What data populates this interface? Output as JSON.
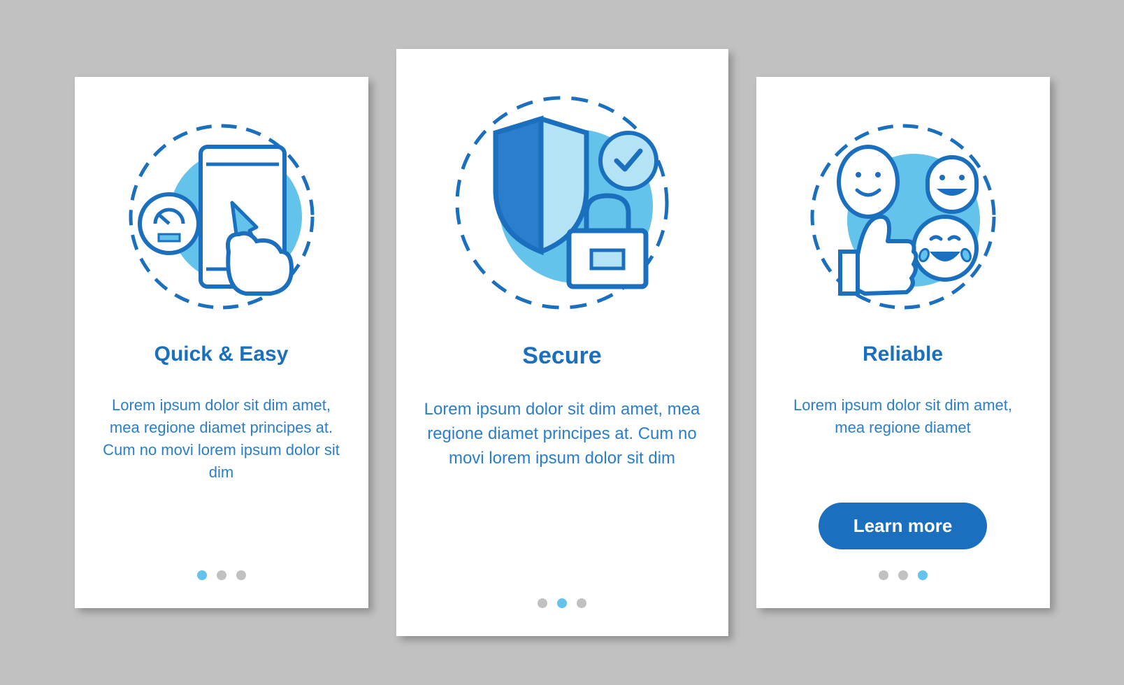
{
  "colors": {
    "primary": "#1a6fbf",
    "accent": "#63c3ea",
    "light": "#b4e3f6",
    "text": "#2a7ecb",
    "inactive": "#c1c1c1"
  },
  "cards": [
    {
      "icon": "speed-tap-icon",
      "title": "Quick & Easy",
      "body": "Lorem ipsum dolor sit dim amet, mea regione diamet principes at. Cum no movi lorem ipsum dolor sit dim",
      "activeDot": 0,
      "cta": null
    },
    {
      "icon": "shield-lock-icon",
      "title": "Secure",
      "body": "Lorem ipsum dolor sit dim amet, mea regione diamet principes at. Cum no movi lorem ipsum dolor sit dim",
      "activeDot": 1,
      "cta": null
    },
    {
      "icon": "thumbs-up-icon",
      "title": "Reliable",
      "body": "Lorem ipsum dolor sit dim amet, mea regione diamet",
      "activeDot": 2,
      "cta": "Learn more"
    }
  ]
}
